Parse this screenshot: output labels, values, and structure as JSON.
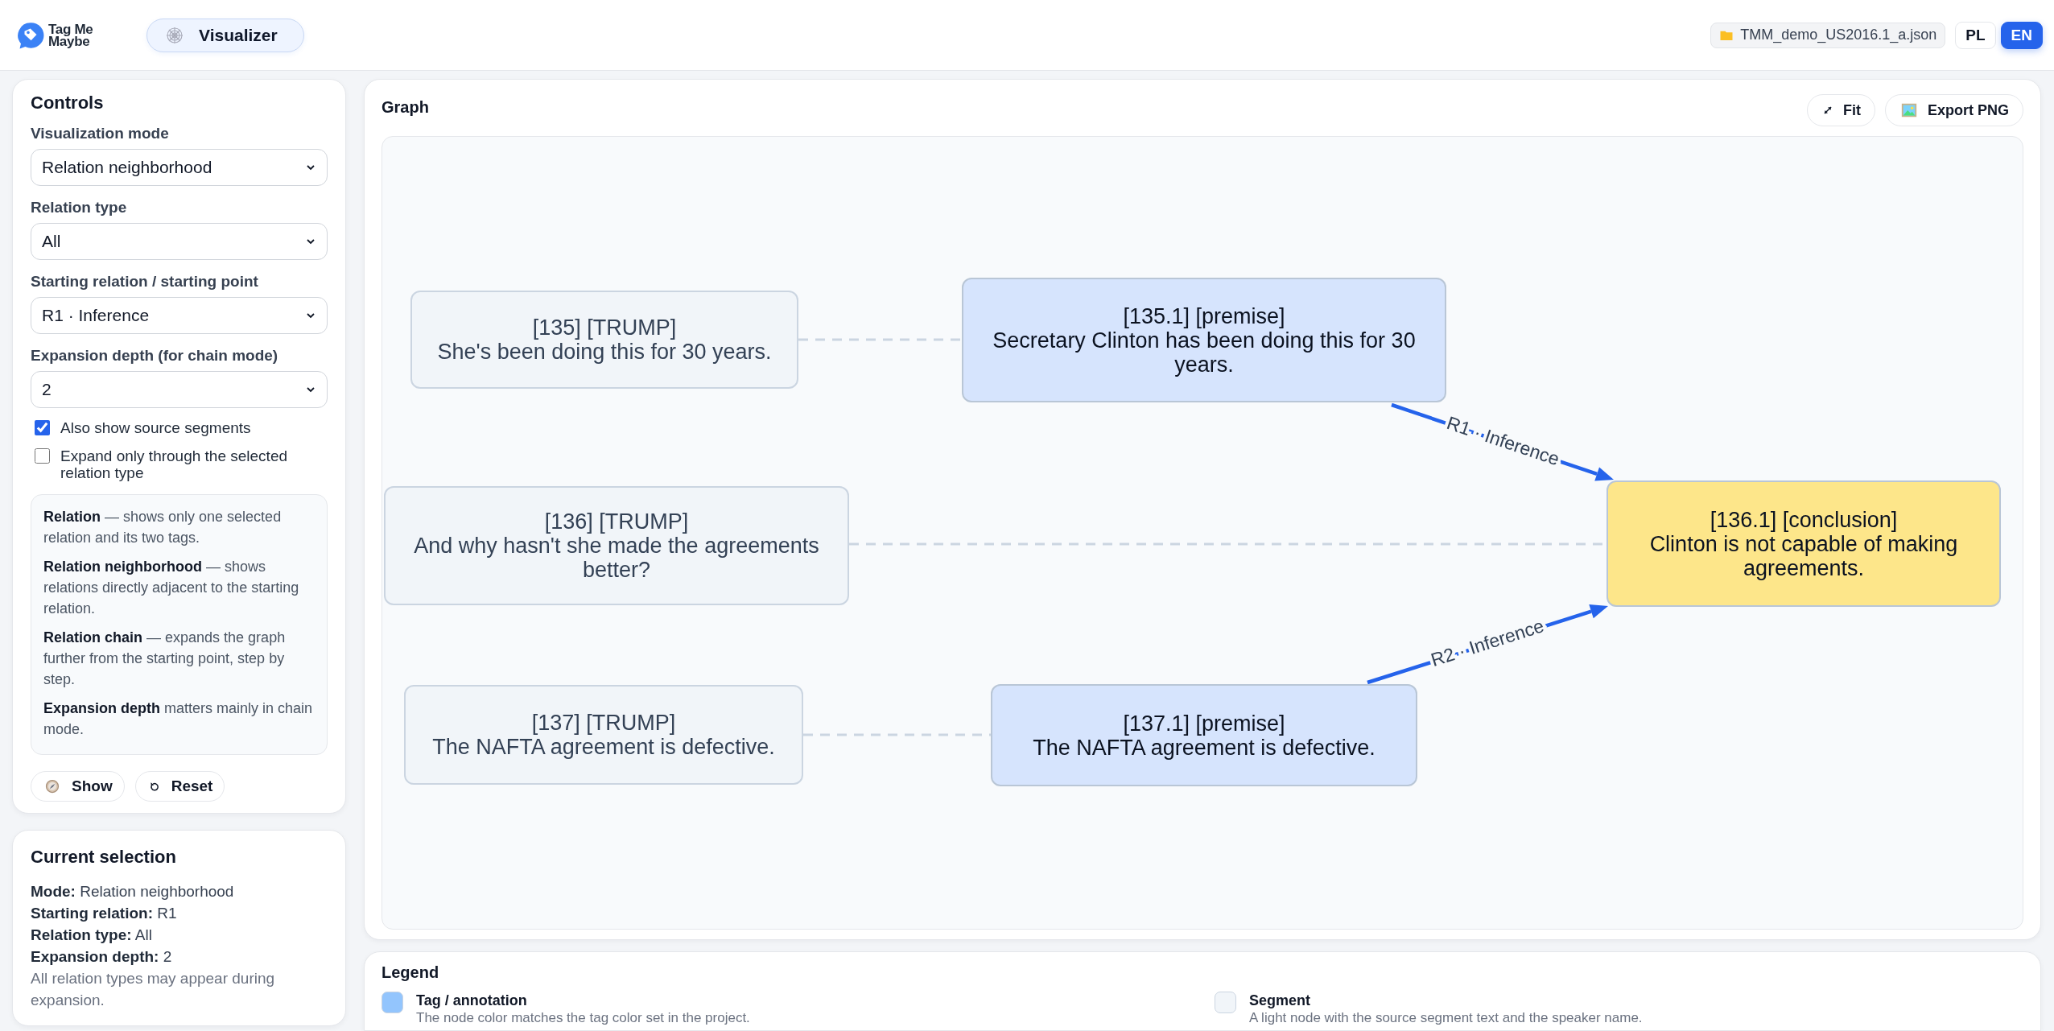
{
  "header": {
    "logo_text": "Tag Me Maybe",
    "nav_tab": {
      "label": "Visualizer",
      "selected": true
    },
    "file_name": "TMM_demo_US2016.1_a.json",
    "languages": [
      {
        "label": "PL",
        "selected": false
      },
      {
        "label": "EN",
        "selected": true
      }
    ]
  },
  "controls": {
    "title": "Controls",
    "fields": [
      {
        "label": "Visualization mode",
        "value": "Relation neighborhood"
      },
      {
        "label": "Relation type",
        "value": "All"
      },
      {
        "label": "Starting relation / starting point",
        "value": "R1 · Inference"
      },
      {
        "label": "Expansion depth (for chain mode)",
        "value": "2"
      }
    ],
    "checkboxes": [
      {
        "label": "Also show source segments",
        "checked": true
      },
      {
        "label": "Expand only through the selected relation type",
        "checked": false
      }
    ],
    "help": [
      "**Relation** — shows only one selected relation and its two tags.",
      "**Relation neighborhood** — shows relations directly adjacent to the starting relation.",
      "**Relation chain** — expands the graph further from the starting point, step by step.",
      "**Expansion depth** matters mainly in chain mode."
    ],
    "buttons": [
      {
        "kind": "show",
        "label": "Show"
      },
      {
        "kind": "reset",
        "label": "Reset"
      }
    ]
  },
  "current_selection": {
    "title": "Current selection",
    "details": [
      "**Mode:** Relation neighborhood",
      "**Starting relation:** R1",
      "**Relation type:** All",
      "**Expansion depth:** 2"
    ],
    "note": "All relation types may appear during expansion."
  },
  "graph": {
    "title": "Graph",
    "buttons": [
      {
        "kind": "fit",
        "label": "Fit"
      },
      {
        "kind": "export",
        "label": "Export PNG"
      }
    ],
    "nodes": [
      {
        "kind": "segment",
        "heading": "[135] [TRUMP]",
        "text": "She's been doing this for 30 years.",
        "color": "#f1f5f9"
      },
      {
        "kind": "tag",
        "heading": "[135.1] [premise]",
        "text": "Secretary Clinton has been doing this for 30 years.",
        "color": "#d6e4fd"
      },
      {
        "kind": "segment",
        "heading": "[136] [TRUMP]",
        "text": "And why hasn't she made the agreements better?",
        "color": "#f1f5f9"
      },
      {
        "kind": "tag",
        "heading": "[136.1] [conclusion]",
        "text": "Clinton is not capable of making agreements.",
        "color": "#fde68a"
      },
      {
        "kind": "segment",
        "heading": "[137] [TRUMP]",
        "text": "The NAFTA agreement is defective.",
        "color": "#f1f5f9"
      },
      {
        "kind": "tag",
        "heading": "[137.1] [premise]",
        "text": "The NAFTA agreement is defective.",
        "color": "#d6e4fd"
      }
    ],
    "edges": [
      {
        "kind": "source"
      },
      {
        "kind": "source"
      },
      {
        "kind": "source"
      },
      {
        "kind": "relation",
        "label": "R1 · Inference"
      },
      {
        "kind": "relation",
        "label": "R2 · Inference"
      }
    ]
  },
  "legend": {
    "title": "Legend",
    "items": [
      {
        "label": "Tag / annotation",
        "description": "The node color matches the tag color set in the project.",
        "color": "#93c5fd"
      },
      {
        "label": "Segment",
        "description": "A light node with the source segment text and the speaker name.",
        "color": "#f1f5f9"
      }
    ]
  }
}
